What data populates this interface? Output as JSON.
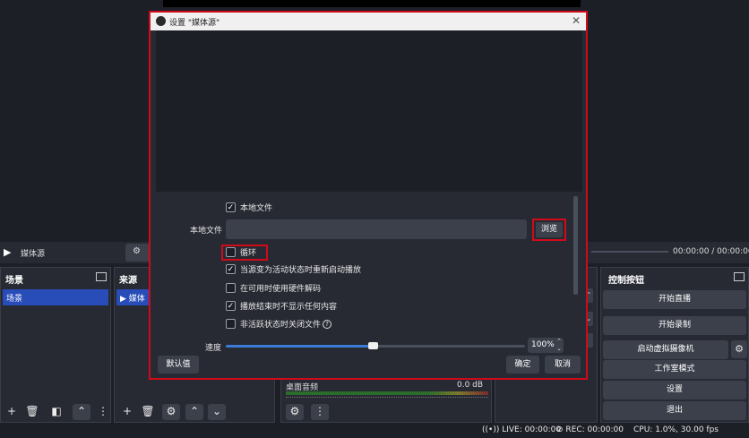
{
  "media_controls": {
    "source_name": "媒体源",
    "properties_label": "设",
    "time": "00:00:00  /  00:00:00"
  },
  "docks": {
    "scenes": {
      "title": "场景",
      "items": [
        "场景"
      ]
    },
    "sources": {
      "title": "来源",
      "items": [
        "媒体"
      ]
    },
    "controls": {
      "title": "控制按钮",
      "buttons": [
        "开始直播",
        "开始录制",
        "启动虚拟摄像机",
        "工作室模式",
        "设置",
        "退出"
      ]
    }
  },
  "audio_mixer": {
    "channel": "桌面音频",
    "level": "0.0 dB"
  },
  "status_bar": {
    "live": "LIVE: 00:00:00",
    "rec": "REC: 00:00:00",
    "cpu": "CPU: 1.0%, 30.00 fps"
  },
  "dialog": {
    "title": "设置 \"媒体源\"",
    "local_file_checkbox": {
      "label": "本地文件",
      "checked": true
    },
    "local_file_field": {
      "label": "本地文件",
      "value": ""
    },
    "browse_label": "浏览",
    "options": [
      {
        "label": "循环",
        "checked": false
      },
      {
        "label": "当源变为活动状态时重新启动播放",
        "checked": true
      },
      {
        "label": "在可用时使用硬件解码",
        "checked": false
      },
      {
        "label": "播放结束时不显示任何内容",
        "checked": true
      },
      {
        "label": "非活跃状态时关闭文件",
        "checked": false
      }
    ],
    "speed": {
      "label": "速度",
      "value": "100%",
      "slider_fraction": 0.49
    },
    "buttons": {
      "defaults": "默认值",
      "ok": "确定",
      "cancel": "取消"
    }
  }
}
